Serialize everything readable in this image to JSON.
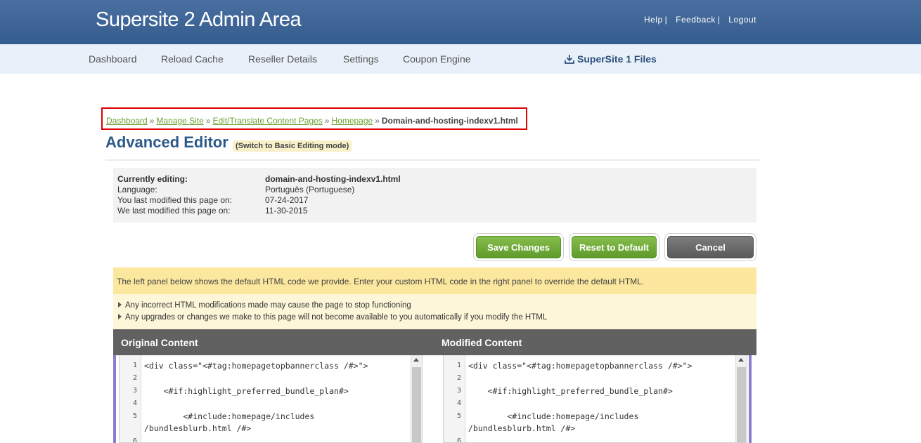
{
  "header": {
    "title": "Supersite 2 Admin Area",
    "links": {
      "help": "Help",
      "feedback": "Feedback",
      "logout": "Logout",
      "separator": "|"
    }
  },
  "nav": {
    "dashboard": "Dashboard",
    "reload_cache": "Reload Cache",
    "reseller_details": "Reseller Details",
    "settings": "Settings",
    "coupon_engine": "Coupon Engine",
    "supersite1_files": "SuperSite 1 Files"
  },
  "breadcrumb": {
    "items": [
      "Dashboard",
      "Manage Site",
      "Edit/Translate Content Pages",
      "Homepage"
    ],
    "separator": "»",
    "current": "Domain-and-hosting-indexv1.html"
  },
  "page": {
    "title": "Advanced Editor",
    "switch_mode": "(Switch to Basic Editing mode)"
  },
  "info": {
    "currently_editing_label": "Currently editing:",
    "currently_editing_value": "domain-and-hosting-indexv1.html",
    "language_label": "Language:",
    "language_value": "Português (Portuguese)",
    "you_modified_label": "You last modified this page on:",
    "you_modified_value": "07-24-2017",
    "we_modified_label": "We last modified this page on:",
    "we_modified_value": "11-30-2015"
  },
  "buttons": {
    "save": "Save Changes",
    "reset": "Reset to Default",
    "cancel": "Cancel"
  },
  "notice": {
    "text": "The left panel below shows the default HTML code we provide. Enter your custom HTML code in the right panel to override the default HTML.",
    "bullets": [
      "Any incorrect HTML modifications made may cause the page to stop functioning",
      "Any upgrades or changes we make to this page will not become available to you automatically if you modify the HTML"
    ]
  },
  "panels": {
    "original_label": "Original Content",
    "modified_label": "Modified Content",
    "line_numbers": [
      "1",
      "2",
      "3",
      "4",
      "5",
      "6"
    ],
    "code_lines": [
      "<div class=\"<#tag:homepagetopbannerclass /#>\">",
      "",
      "    <#if:highlight_preferred_bundle_plan#>",
      "",
      "        <#include:homepage/includes",
      "/bundlesblurb.html /#>"
    ]
  },
  "colors": {
    "header_bg": "#3d6596",
    "nav_bg": "#e8f0f9",
    "accent_green": "#6aa033",
    "highlight_red": "#e00000",
    "notice_bg": "#fbe79d",
    "panel_header_bg": "#616161"
  }
}
